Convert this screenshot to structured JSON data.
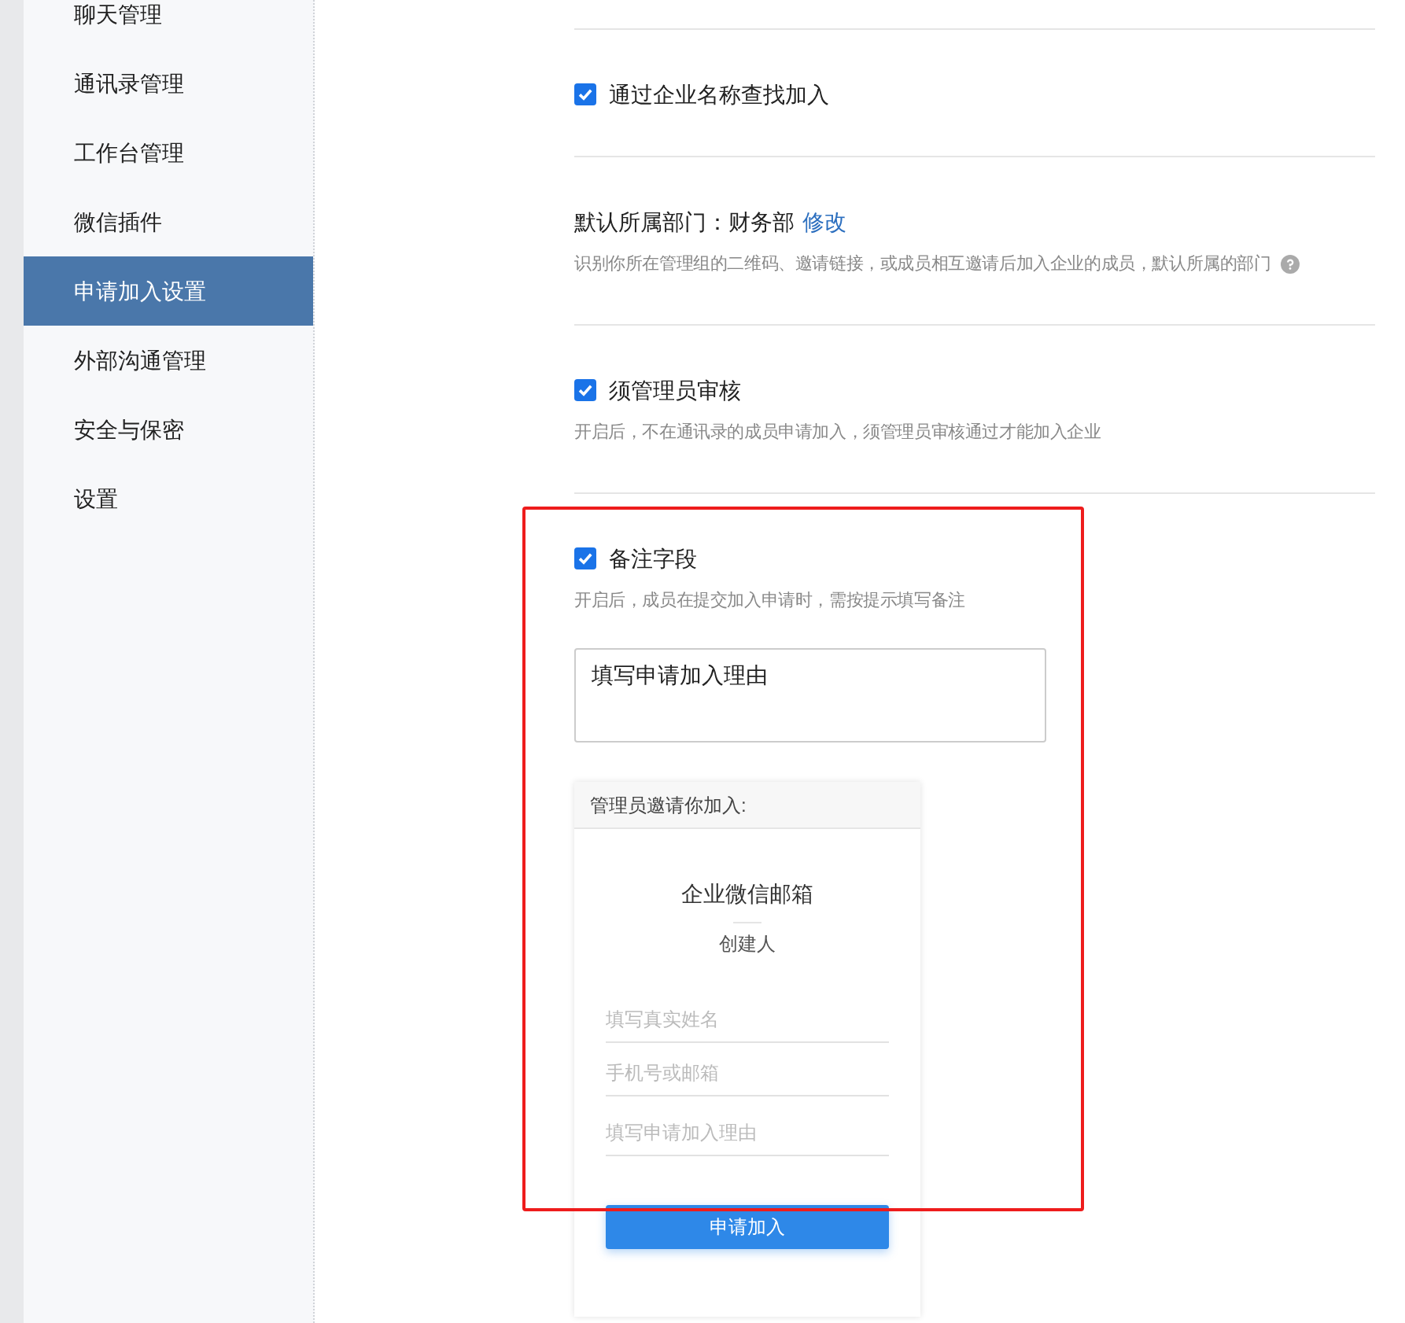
{
  "sidebar": {
    "items": [
      {
        "label": "聊天管理",
        "selected": false
      },
      {
        "label": "通讯录管理",
        "selected": false
      },
      {
        "label": "工作台管理",
        "selected": false
      },
      {
        "label": "微信插件",
        "selected": false
      },
      {
        "label": "申请加入设置",
        "selected": true
      },
      {
        "label": "外部沟通管理",
        "selected": false
      },
      {
        "label": "安全与保密",
        "selected": false
      },
      {
        "label": "设置",
        "selected": false
      }
    ]
  },
  "settings": [
    {
      "kind": "checkbox",
      "label": "通过企业名称查找加入",
      "checked": true
    },
    {
      "kind": "department",
      "label": "默认所属部门：财务部",
      "link": "修改",
      "description": "识别你所在管理组的二维码、邀请链接，或成员相互邀请后加入企业的成员，默认所属的部门"
    },
    {
      "kind": "checkbox",
      "label": "须管理员审核",
      "checked": true,
      "description": "开启后，不在通讯录的成员申请加入，须管理员审核通过才能加入企业"
    },
    {
      "kind": "checkbox",
      "label": "备注字段",
      "checked": true,
      "highlighted": true,
      "description": "开启后，成员在提交加入申请时，需按提示填写备注",
      "textarea": {
        "value": "填写申请加入理由"
      },
      "preview": {
        "header": "管理员邀请你加入:",
        "title": "企业微信邮箱",
        "subtitle": "创建人",
        "fields": [
          {
            "placeholder": "填写真实姓名"
          },
          {
            "placeholder": "手机号或邮箱"
          },
          {
            "placeholder": "填写申请加入理由"
          }
        ],
        "button": "申请加入"
      }
    }
  ]
}
